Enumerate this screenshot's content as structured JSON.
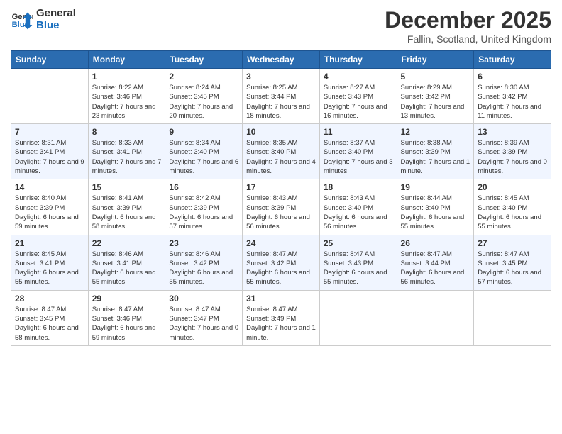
{
  "header": {
    "logo_line1": "General",
    "logo_line2": "Blue",
    "month_title": "December 2025",
    "location": "Fallin, Scotland, United Kingdom"
  },
  "weekdays": [
    "Sunday",
    "Monday",
    "Tuesday",
    "Wednesday",
    "Thursday",
    "Friday",
    "Saturday"
  ],
  "weeks": [
    [
      {
        "day": "",
        "sunrise": "",
        "sunset": "",
        "daylight": ""
      },
      {
        "day": "1",
        "sunrise": "Sunrise: 8:22 AM",
        "sunset": "Sunset: 3:46 PM",
        "daylight": "Daylight: 7 hours and 23 minutes."
      },
      {
        "day": "2",
        "sunrise": "Sunrise: 8:24 AM",
        "sunset": "Sunset: 3:45 PM",
        "daylight": "Daylight: 7 hours and 20 minutes."
      },
      {
        "day": "3",
        "sunrise": "Sunrise: 8:25 AM",
        "sunset": "Sunset: 3:44 PM",
        "daylight": "Daylight: 7 hours and 18 minutes."
      },
      {
        "day": "4",
        "sunrise": "Sunrise: 8:27 AM",
        "sunset": "Sunset: 3:43 PM",
        "daylight": "Daylight: 7 hours and 16 minutes."
      },
      {
        "day": "5",
        "sunrise": "Sunrise: 8:29 AM",
        "sunset": "Sunset: 3:42 PM",
        "daylight": "Daylight: 7 hours and 13 minutes."
      },
      {
        "day": "6",
        "sunrise": "Sunrise: 8:30 AM",
        "sunset": "Sunset: 3:42 PM",
        "daylight": "Daylight: 7 hours and 11 minutes."
      }
    ],
    [
      {
        "day": "7",
        "sunrise": "Sunrise: 8:31 AM",
        "sunset": "Sunset: 3:41 PM",
        "daylight": "Daylight: 7 hours and 9 minutes."
      },
      {
        "day": "8",
        "sunrise": "Sunrise: 8:33 AM",
        "sunset": "Sunset: 3:41 PM",
        "daylight": "Daylight: 7 hours and 7 minutes."
      },
      {
        "day": "9",
        "sunrise": "Sunrise: 8:34 AM",
        "sunset": "Sunset: 3:40 PM",
        "daylight": "Daylight: 7 hours and 6 minutes."
      },
      {
        "day": "10",
        "sunrise": "Sunrise: 8:35 AM",
        "sunset": "Sunset: 3:40 PM",
        "daylight": "Daylight: 7 hours and 4 minutes."
      },
      {
        "day": "11",
        "sunrise": "Sunrise: 8:37 AM",
        "sunset": "Sunset: 3:40 PM",
        "daylight": "Daylight: 7 hours and 3 minutes."
      },
      {
        "day": "12",
        "sunrise": "Sunrise: 8:38 AM",
        "sunset": "Sunset: 3:39 PM",
        "daylight": "Daylight: 7 hours and 1 minute."
      },
      {
        "day": "13",
        "sunrise": "Sunrise: 8:39 AM",
        "sunset": "Sunset: 3:39 PM",
        "daylight": "Daylight: 7 hours and 0 minutes."
      }
    ],
    [
      {
        "day": "14",
        "sunrise": "Sunrise: 8:40 AM",
        "sunset": "Sunset: 3:39 PM",
        "daylight": "Daylight: 6 hours and 59 minutes."
      },
      {
        "day": "15",
        "sunrise": "Sunrise: 8:41 AM",
        "sunset": "Sunset: 3:39 PM",
        "daylight": "Daylight: 6 hours and 58 minutes."
      },
      {
        "day": "16",
        "sunrise": "Sunrise: 8:42 AM",
        "sunset": "Sunset: 3:39 PM",
        "daylight": "Daylight: 6 hours and 57 minutes."
      },
      {
        "day": "17",
        "sunrise": "Sunrise: 8:43 AM",
        "sunset": "Sunset: 3:39 PM",
        "daylight": "Daylight: 6 hours and 56 minutes."
      },
      {
        "day": "18",
        "sunrise": "Sunrise: 8:43 AM",
        "sunset": "Sunset: 3:40 PM",
        "daylight": "Daylight: 6 hours and 56 minutes."
      },
      {
        "day": "19",
        "sunrise": "Sunrise: 8:44 AM",
        "sunset": "Sunset: 3:40 PM",
        "daylight": "Daylight: 6 hours and 55 minutes."
      },
      {
        "day": "20",
        "sunrise": "Sunrise: 8:45 AM",
        "sunset": "Sunset: 3:40 PM",
        "daylight": "Daylight: 6 hours and 55 minutes."
      }
    ],
    [
      {
        "day": "21",
        "sunrise": "Sunrise: 8:45 AM",
        "sunset": "Sunset: 3:41 PM",
        "daylight": "Daylight: 6 hours and 55 minutes."
      },
      {
        "day": "22",
        "sunrise": "Sunrise: 8:46 AM",
        "sunset": "Sunset: 3:41 PM",
        "daylight": "Daylight: 6 hours and 55 minutes."
      },
      {
        "day": "23",
        "sunrise": "Sunrise: 8:46 AM",
        "sunset": "Sunset: 3:42 PM",
        "daylight": "Daylight: 6 hours and 55 minutes."
      },
      {
        "day": "24",
        "sunrise": "Sunrise: 8:47 AM",
        "sunset": "Sunset: 3:42 PM",
        "daylight": "Daylight: 6 hours and 55 minutes."
      },
      {
        "day": "25",
        "sunrise": "Sunrise: 8:47 AM",
        "sunset": "Sunset: 3:43 PM",
        "daylight": "Daylight: 6 hours and 55 minutes."
      },
      {
        "day": "26",
        "sunrise": "Sunrise: 8:47 AM",
        "sunset": "Sunset: 3:44 PM",
        "daylight": "Daylight: 6 hours and 56 minutes."
      },
      {
        "day": "27",
        "sunrise": "Sunrise: 8:47 AM",
        "sunset": "Sunset: 3:45 PM",
        "daylight": "Daylight: 6 hours and 57 minutes."
      }
    ],
    [
      {
        "day": "28",
        "sunrise": "Sunrise: 8:47 AM",
        "sunset": "Sunset: 3:45 PM",
        "daylight": "Daylight: 6 hours and 58 minutes."
      },
      {
        "day": "29",
        "sunrise": "Sunrise: 8:47 AM",
        "sunset": "Sunset: 3:46 PM",
        "daylight": "Daylight: 6 hours and 59 minutes."
      },
      {
        "day": "30",
        "sunrise": "Sunrise: 8:47 AM",
        "sunset": "Sunset: 3:47 PM",
        "daylight": "Daylight: 7 hours and 0 minutes."
      },
      {
        "day": "31",
        "sunrise": "Sunrise: 8:47 AM",
        "sunset": "Sunset: 3:49 PM",
        "daylight": "Daylight: 7 hours and 1 minute."
      },
      {
        "day": "",
        "sunrise": "",
        "sunset": "",
        "daylight": ""
      },
      {
        "day": "",
        "sunrise": "",
        "sunset": "",
        "daylight": ""
      },
      {
        "day": "",
        "sunrise": "",
        "sunset": "",
        "daylight": ""
      }
    ]
  ]
}
